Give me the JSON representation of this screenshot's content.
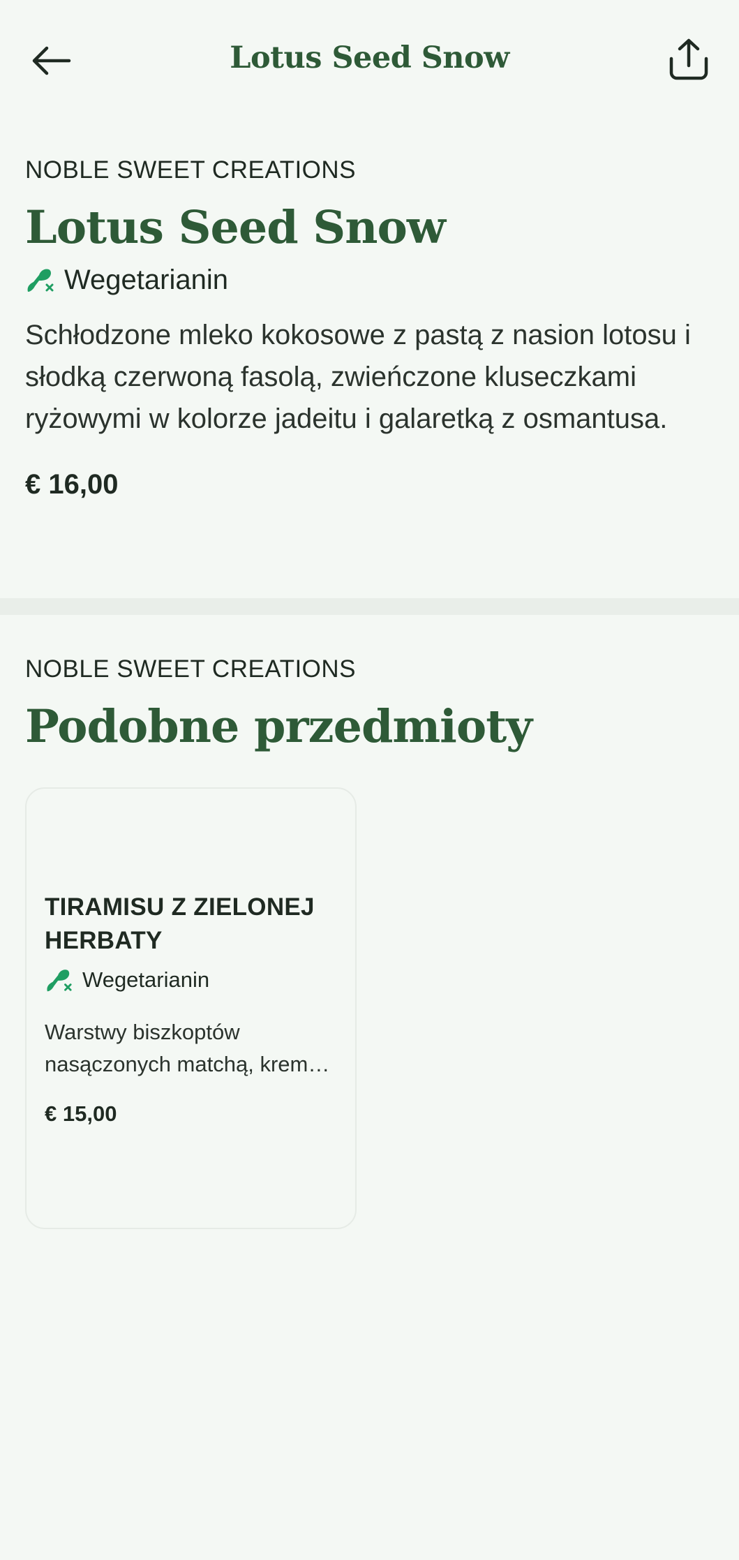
{
  "header": {
    "title": "Lotus Seed Snow",
    "back_icon": "arrow-left-icon",
    "share_icon": "share-icon"
  },
  "product": {
    "brand": "NOBLE SWEET CREATIONS",
    "title": "Lotus Seed Snow",
    "diet_label": "Wegetarianin",
    "diet_icon": "vegetarian-icon",
    "description": "Schłodzone mleko kokosowe z pastą z nasion lotosu i słodką czerwoną fasolą, zwieńczone kluseczkami ryżowymi w kolorze jadeitu i galaretką z osmantusa.",
    "price": "€ 16,00"
  },
  "similar": {
    "brand": "NOBLE SWEET CREATIONS",
    "heading": "Podobne przedmioty",
    "items": [
      {
        "name": "TIRAMISU Z ZIELONEJ HERBATY",
        "diet_label": "Wegetarianin",
        "description": "Warstwy biszkoptów nasączonych matchą, krem…",
        "price": "€ 15,00"
      }
    ]
  },
  "colors": {
    "accent_green": "#2e5a37",
    "vegetarian_green": "#1f9e62",
    "background": "#f4f8f4"
  }
}
